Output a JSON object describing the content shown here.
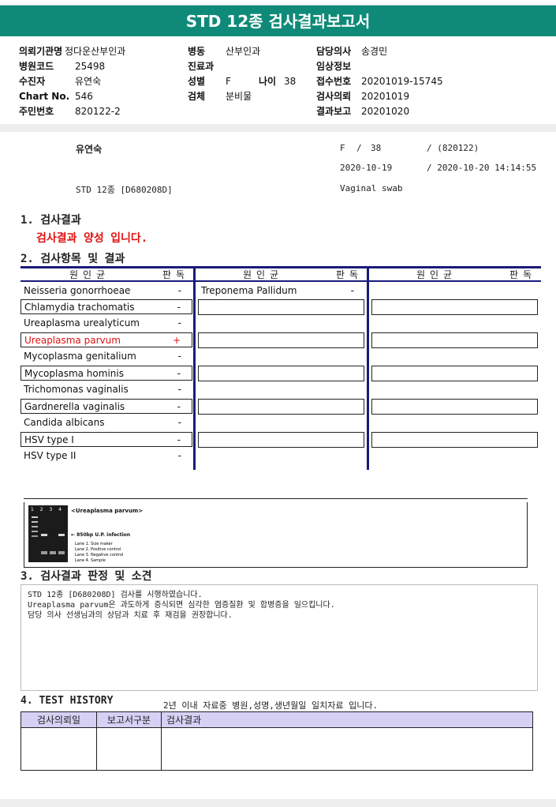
{
  "title": "STD 12종 검사결과보고서",
  "header": {
    "left": [
      {
        "label": "의뢰기관명",
        "value": "정다운산부인과"
      },
      {
        "label": "병원코드",
        "value": "25498"
      },
      {
        "label": "수진자",
        "value": "유연숙"
      },
      {
        "label": "Chart No.",
        "value": "546"
      },
      {
        "label": "주민번호",
        "value": "820122-2"
      }
    ],
    "middle": {
      "dept_label": "병동",
      "dept_value": "산부인과",
      "clinic_label": "진료과",
      "sex_label": "성별",
      "sex_value": "F",
      "age_label": "나이",
      "age_value": "38",
      "specimen_label": "검체",
      "specimen_value": "분비물"
    },
    "right": [
      {
        "label": "담당의사",
        "value": "송경민"
      },
      {
        "label": "임상정보",
        "value": ""
      },
      {
        "label": "접수번호",
        "value": "20201019-15745"
      },
      {
        "label": "검사의뢰",
        "value": "20201019"
      },
      {
        "label": "결과보고",
        "value": "20201020"
      }
    ]
  },
  "patient_summary": {
    "name": "유연숙",
    "sex": "F",
    "sep1": "/",
    "age": "38",
    "birth": "/ (820122)",
    "req_date": "2020-10-19",
    "report_datetime": "/ 2020-10-20 14:14:55",
    "test_code": "STD 12종 [D680208D]",
    "specimen": "Vaginal swab"
  },
  "section1": {
    "heading": "1. 검사결과",
    "result_text": "검사결과 양성 입니다."
  },
  "section2": {
    "heading": "2. 검사항목 및 결과",
    "col_pathogen": "원인균",
    "col_judgement": "판독",
    "col1": [
      {
        "name": "Neisseria gonorrhoeae",
        "result": "-",
        "positive": false
      },
      {
        "name": "Chlamydia trachomatis",
        "result": "-",
        "positive": false
      },
      {
        "name": "Ureaplasma urealyticum",
        "result": "-",
        "positive": false
      },
      {
        "name": "Ureaplasma parvum",
        "result": "+",
        "positive": true
      },
      {
        "name": "Mycoplasma genitalium",
        "result": "-",
        "positive": false
      },
      {
        "name": "Mycoplasma hominis",
        "result": "-",
        "positive": false
      },
      {
        "name": "Trichomonas vaginalis",
        "result": "-",
        "positive": false
      },
      {
        "name": "Gardnerella vaginalis",
        "result": "-",
        "positive": false
      },
      {
        "name": "Candida albicans",
        "result": "-",
        "positive": false
      },
      {
        "name": "HSV type I",
        "result": "-",
        "positive": false
      },
      {
        "name": "HSV type II",
        "result": "-",
        "positive": false
      }
    ],
    "col2": [
      {
        "name": "Treponema Pallidum",
        "result": "-"
      }
    ]
  },
  "gel_image": {
    "lanes": "1 2 3 4",
    "title": "<Ureaplasma parvum>",
    "band_label": "← 850bp U.P. infection",
    "legend": [
      "Lane 1. Size maker",
      "Lane 2. Positive control",
      "Lane 3. Negative control",
      "Lane 4. Sample"
    ]
  },
  "section3": {
    "heading": "3. 검사결과 판정 및 소견",
    "lines": [
      "STD 12종 [D680208D] 검사를 시행하였습니다.",
      "Ureaplasma parvum은 과도하게 증식되면 심각한 염증질환 및 합병증을 일으킵니다.",
      "담당 의사 선생님과의 상담과 치료 후 재검을 권장합니다."
    ]
  },
  "section4": {
    "heading": "4. TEST HISTORY",
    "note": "2년 이내 자료중 병원,성명,생년월일 일치자료 입니다.",
    "columns": [
      "검사의뢰일",
      "보고서구분",
      "검사결과"
    ]
  },
  "colors": {
    "title_bar": "#0f8a78",
    "positive": "#e01010",
    "table_rule": "#1a1a7a",
    "history_header": "#d6d1f4"
  }
}
